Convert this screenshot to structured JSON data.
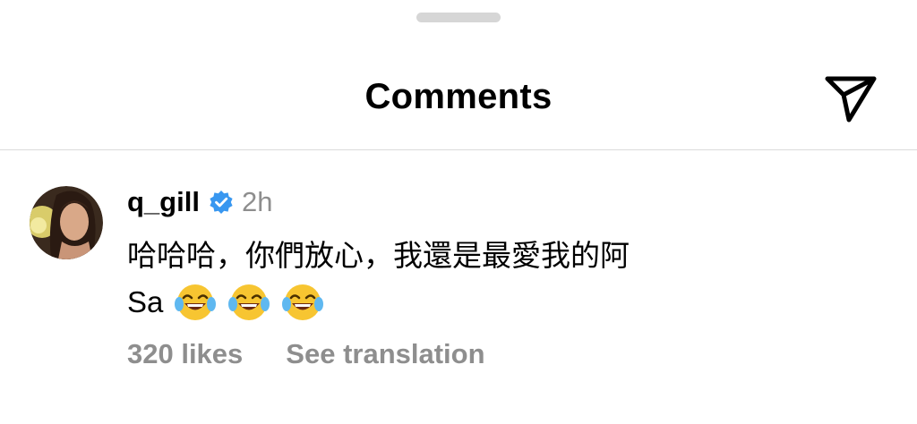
{
  "header": {
    "title": "Comments",
    "share_icon": "paper-plane-icon"
  },
  "comment": {
    "username": "q_gill",
    "verified_icon": "verified-badge-icon",
    "verified_color": "#3897f0",
    "time": "2h",
    "text_line1": "哈哈哈，你們放心，我還是最愛我的阿",
    "text_line2": "Sa",
    "emojis": [
      "face-with-tears-of-joy-icon",
      "face-with-tears-of-joy-icon",
      "face-with-tears-of-joy-icon"
    ],
    "likes": "320 likes",
    "translate_label": "See translation"
  }
}
